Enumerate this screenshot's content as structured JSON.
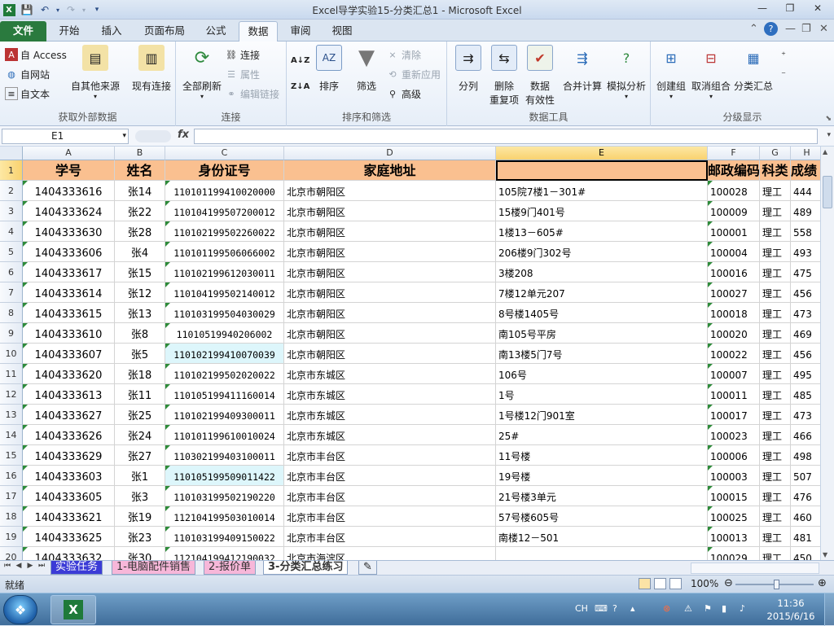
{
  "window": {
    "title": "Excel导学实验15-分类汇总1 - Microsoft Excel",
    "min": "—",
    "max": "❐",
    "close": "✕"
  },
  "ribbon_tabs": [
    "文件",
    "开始",
    "插入",
    "页面布局",
    "公式",
    "数据",
    "审阅",
    "视图"
  ],
  "ribbon": {
    "get_external": {
      "label": "获取外部数据",
      "access": "自 Access",
      "web": "自网站",
      "text": "自文本",
      "other": "自其他来源",
      "existing": "现有连接"
    },
    "connections": {
      "label": "连接",
      "refresh_all": "全部刷新",
      "connections": "连接",
      "properties": "属性",
      "edit_links": "编辑链接"
    },
    "sort_filter": {
      "label": "排序和筛选",
      "sort_az": "A↓Z",
      "sort_za": "Z↓A",
      "sort": "排序",
      "filter": "筛选",
      "clear": "清除",
      "reapply": "重新应用",
      "advanced": "高级"
    },
    "data_tools": {
      "label": "数据工具",
      "split": "分列",
      "remove_dup_1": "删除",
      "remove_dup_2": "重复项",
      "validation_1": "数据",
      "validation_2": "有效性",
      "consolidate": "合并计算",
      "whatif": "模拟分析"
    },
    "outline": {
      "label": "分级显示",
      "group": "创建组",
      "ungroup": "取消组合",
      "subtotal": "分类汇总"
    }
  },
  "formula_bar": {
    "name_box": "E1",
    "fx": "fx",
    "value": ""
  },
  "columns": [
    "A",
    "B",
    "C",
    "D",
    "E",
    "F",
    "G",
    "H"
  ],
  "headers": {
    "A": "学号",
    "B": "姓名",
    "C": "身份证号",
    "D": "家庭地址",
    "E": "",
    "F": "邮政编码",
    "G": "科类",
    "H": "成绩"
  },
  "rows": [
    {
      "n": "2",
      "a": "1404333616",
      "b": "张14",
      "c": "110101199410020000",
      "d": "北京市朝阳区",
      "e": "105院7楼1－301#",
      "f": "100028",
      "g": "理工",
      "h": "444"
    },
    {
      "n": "3",
      "a": "1404333624",
      "b": "张22",
      "c": "110104199507200012",
      "d": "北京市朝阳区",
      "e": "15楼9门401号",
      "f": "100009",
      "g": "理工",
      "h": "489"
    },
    {
      "n": "4",
      "a": "1404333630",
      "b": "张28",
      "c": "110102199502260022",
      "d": "北京市朝阳区",
      "e": "1楼13－605#",
      "f": "100001",
      "g": "理工",
      "h": "558"
    },
    {
      "n": "5",
      "a": "1404333606",
      "b": "张4",
      "c": "110101199506066002",
      "d": "北京市朝阳区",
      "e": "206楼9门302号",
      "f": "100004",
      "g": "理工",
      "h": "493"
    },
    {
      "n": "6",
      "a": "1404333617",
      "b": "张15",
      "c": "110102199612030011",
      "d": "北京市朝阳区",
      "e": "3楼208",
      "f": "100016",
      "g": "理工",
      "h": "475"
    },
    {
      "n": "7",
      "a": "1404333614",
      "b": "张12",
      "c": "110104199502140012",
      "d": "北京市朝阳区",
      "e": "7楼12单元207",
      "f": "100027",
      "g": "理工",
      "h": "456"
    },
    {
      "n": "8",
      "a": "1404333615",
      "b": "张13",
      "c": "110103199504030029",
      "d": "北京市朝阳区",
      "e": "8号楼1405号",
      "f": "100018",
      "g": "理工",
      "h": "473"
    },
    {
      "n": "9",
      "a": "1404333610",
      "b": "张8",
      "c": "11010519940206002",
      "d": "北京市朝阳区",
      "e": "南105号平房",
      "f": "100020",
      "g": "理工",
      "h": "469"
    },
    {
      "n": "10",
      "a": "1404333607",
      "b": "张5",
      "c": "110102199410070039",
      "d": "北京市朝阳区",
      "e": "南13楼5门7号",
      "f": "100022",
      "g": "理工",
      "h": "456"
    },
    {
      "n": "11",
      "a": "1404333620",
      "b": "张18",
      "c": "110102199502020022",
      "d": "北京市东城区",
      "e": "106号",
      "f": "100007",
      "g": "理工",
      "h": "495"
    },
    {
      "n": "12",
      "a": "1404333613",
      "b": "张11",
      "c": "110105199411160014",
      "d": "北京市东城区",
      "e": "1号",
      "f": "100011",
      "g": "理工",
      "h": "485"
    },
    {
      "n": "13",
      "a": "1404333627",
      "b": "张25",
      "c": "110102199409300011",
      "d": "北京市东城区",
      "e": "1号楼12门901室",
      "f": "100017",
      "g": "理工",
      "h": "473"
    },
    {
      "n": "14",
      "a": "1404333626",
      "b": "张24",
      "c": "110101199610010024",
      "d": "北京市东城区",
      "e": "25#",
      "f": "100023",
      "g": "理工",
      "h": "466"
    },
    {
      "n": "15",
      "a": "1404333629",
      "b": "张27",
      "c": "110302199403100011",
      "d": "北京市丰台区",
      "e": "11号楼",
      "f": "100006",
      "g": "理工",
      "h": "498"
    },
    {
      "n": "16",
      "a": "1404333603",
      "b": "张1",
      "c": "110105199509011422",
      "d": "北京市丰台区",
      "e": "19号楼",
      "f": "100003",
      "g": "理工",
      "h": "507"
    },
    {
      "n": "17",
      "a": "1404333605",
      "b": "张3",
      "c": "110103199502190220",
      "d": "北京市丰台区",
      "e": "21号楼3单元",
      "f": "100015",
      "g": "理工",
      "h": "476"
    },
    {
      "n": "18",
      "a": "1404333621",
      "b": "张19",
      "c": "112104199503010014",
      "d": "北京市丰台区",
      "e": "57号楼605号",
      "f": "100025",
      "g": "理工",
      "h": "460"
    },
    {
      "n": "19",
      "a": "1404333625",
      "b": "张23",
      "c": "110103199409150022",
      "d": "北京市丰台区",
      "e": "南楼12－501",
      "f": "100013",
      "g": "理工",
      "h": "481"
    },
    {
      "n": "20",
      "a": "1404333632",
      "b": "张30",
      "c": "112104199412190032",
      "d": "北京市海淀区",
      "e": "",
      "f": "100029",
      "g": "理工",
      "h": "450"
    }
  ],
  "highlighted_rows": [
    "10",
    "16"
  ],
  "sheet_tabs": [
    "实验任务",
    "1-电脑配件销售",
    "2-报价单",
    "3-分类汇总练习"
  ],
  "status": {
    "text": "就绪",
    "zoom": "100%",
    "zoom_level_percent": 100
  },
  "taskbar": {
    "lang": "CH",
    "time": "11:36",
    "date": "2015/6/16"
  },
  "colors": {
    "accent_file_tab": "#2a7a3e",
    "header_fill": "#fac090",
    "highlight_fill": "#ddf6fb",
    "selected_col": "#f9d26f"
  }
}
